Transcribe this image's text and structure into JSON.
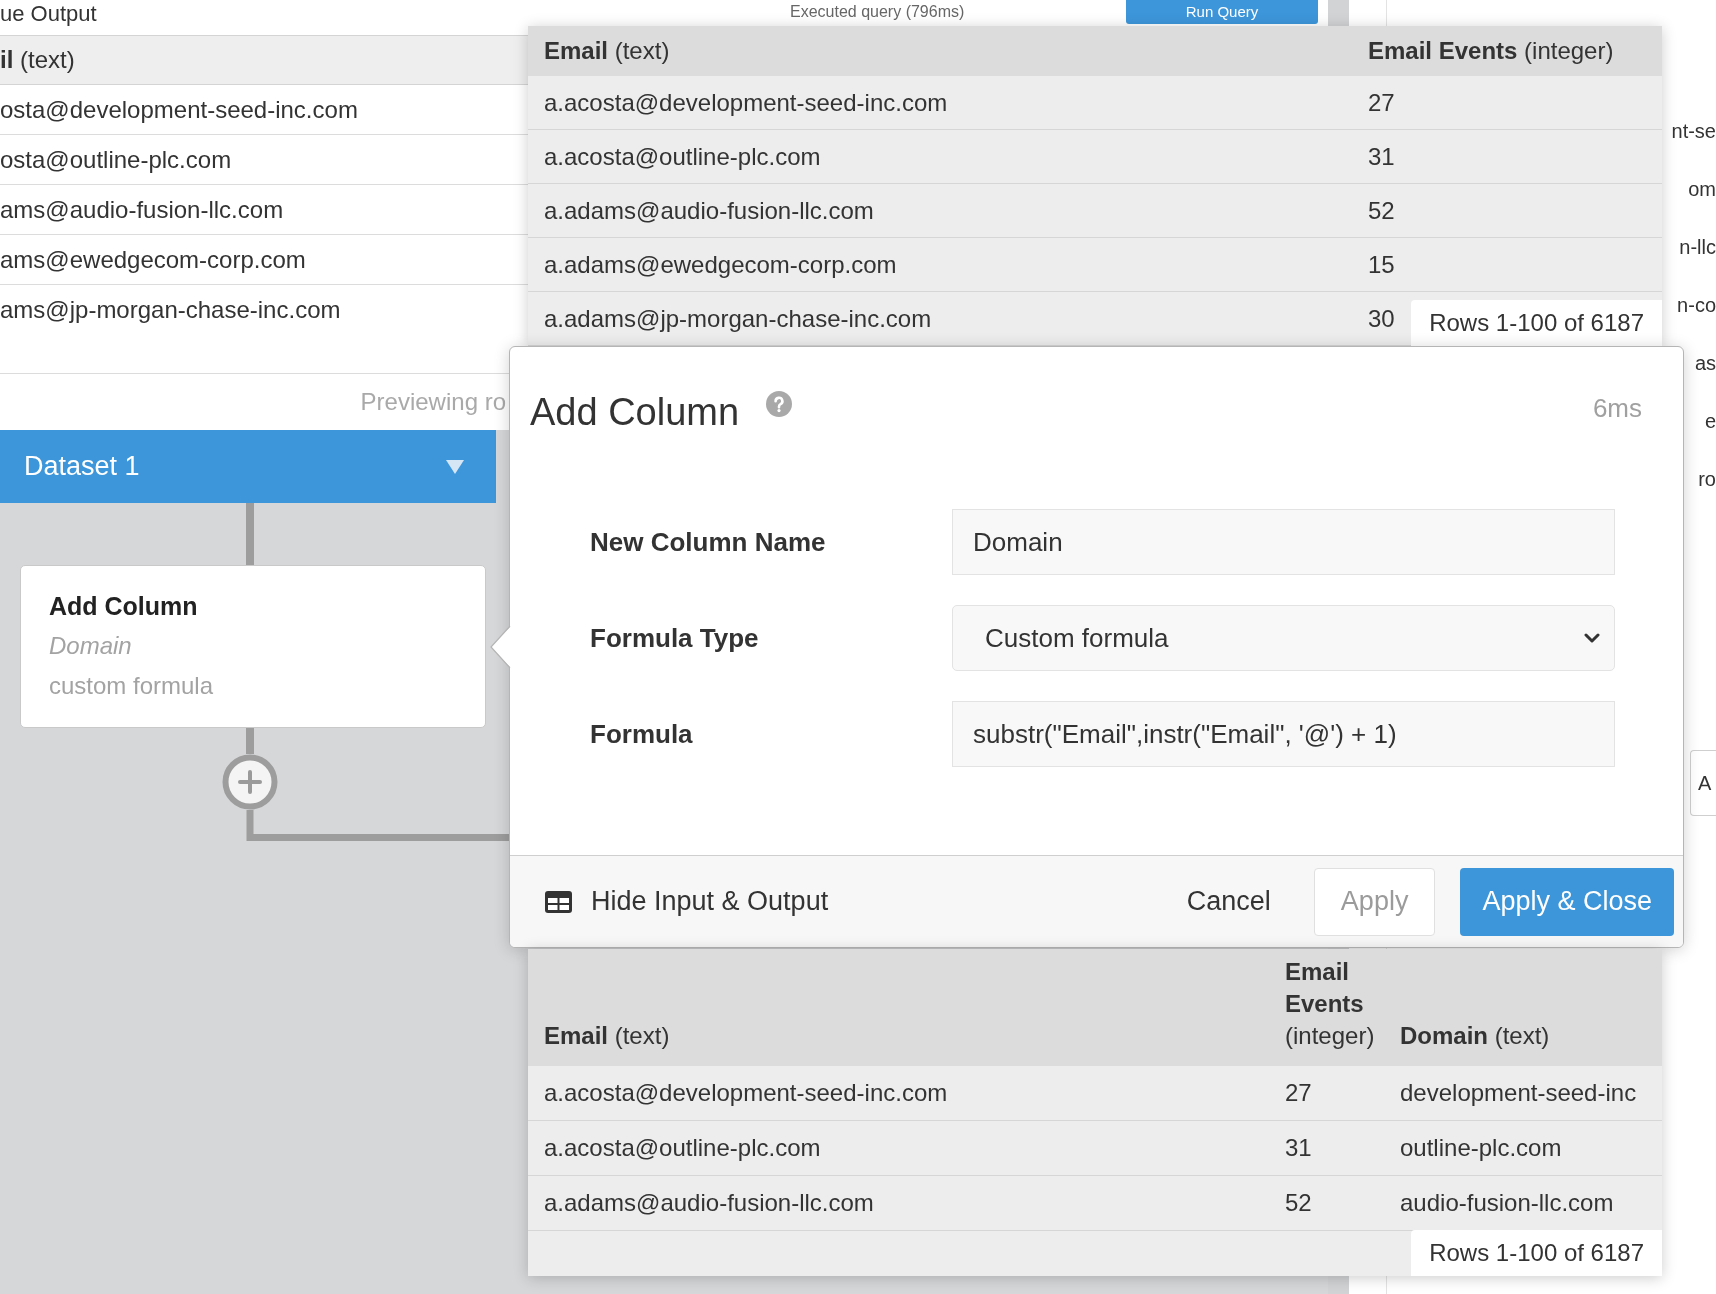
{
  "background": {
    "heading": "ue Output",
    "query_status": "Executed query (796ms)",
    "run_button": {
      "label": "Run Query"
    },
    "table": {
      "header": "**il** (text)",
      "rows": [
        "osta@development-seed-inc.com",
        "osta@outline-plc.com",
        "ams@audio-fusion-llc.com",
        "ams@ewedgecom-corp.com",
        "ams@jp-morgan-chase-inc.com"
      ]
    },
    "preview_note": "Previewing ro",
    "side_fragments": [
      "nt-se",
      "om",
      "n-llc",
      "n-co",
      "as",
      "e",
      "ro"
    ],
    "side_button": {
      "label": "A"
    }
  },
  "pipeline": {
    "dataset": {
      "label": "Dataset 1"
    },
    "steps": [
      {
        "title": "Add Column",
        "column": "Domain",
        "formula_type": "custom formula"
      }
    ]
  },
  "input_preview": {
    "columns": [
      "**Email** (text)",
      "**Email Events** (integer)"
    ],
    "rows": [
      [
        "a.acosta@development-seed-inc.com",
        "27"
      ],
      [
        "a.acosta@outline-plc.com",
        "31"
      ],
      [
        "a.adams@audio-fusion-llc.com",
        "52"
      ],
      [
        "a.adams@ewedgecom-corp.com",
        "15"
      ],
      [
        "a.adams@jp-morgan-chase-inc.com",
        "30"
      ]
    ],
    "row_count": "Rows 1-100 of 6187"
  },
  "dialog": {
    "title": "Add Column",
    "timing": "6ms",
    "fields": [
      {
        "label": "New Column Name",
        "kind": "text",
        "value": "Domain"
      },
      {
        "label": "Formula Type",
        "kind": "select",
        "value": "Custom formula"
      },
      {
        "label": "Formula",
        "kind": "text",
        "value": "substr(\"Email\",instr(\"Email\", '@') + 1)"
      }
    ],
    "toggle": {
      "label": "Hide Input & Output"
    },
    "buttons": [
      {
        "label": "Cancel",
        "kind": "link",
        "disabled": false
      },
      {
        "label": "Apply",
        "kind": "secondary",
        "disabled": true
      },
      {
        "label": "Apply & Close",
        "kind": "primary",
        "disabled": false
      }
    ]
  },
  "output_preview": {
    "columns": [
      "**Email** (text)",
      "**Email Events** (integer)",
      "**Domain** (text)"
    ],
    "rows": [
      [
        "a.acosta@development-seed-inc.com",
        "27",
        "development-seed-inc"
      ],
      [
        "a.acosta@outline-plc.com",
        "31",
        "outline-plc.com"
      ],
      [
        "a.adams@audio-fusion-llc.com",
        "52",
        "audio-fusion-llc.com"
      ]
    ],
    "row_count": "Rows 1-100 of 6187"
  }
}
